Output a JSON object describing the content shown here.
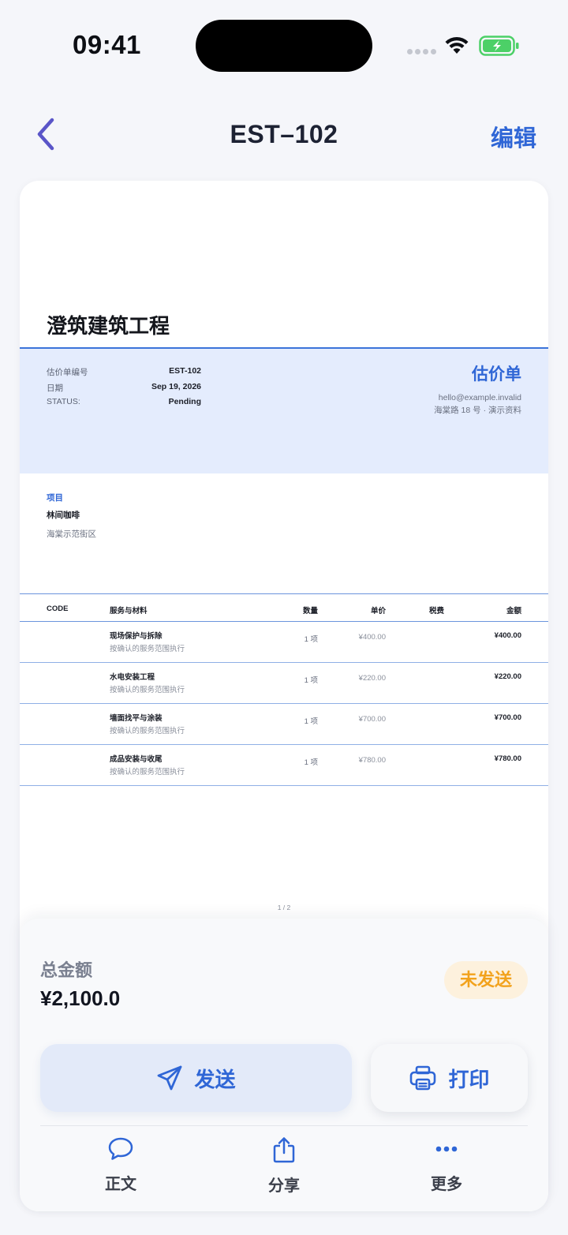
{
  "status_bar": {
    "time": "09:41"
  },
  "nav": {
    "title": "EST–102",
    "edit_label": "编辑"
  },
  "document": {
    "company": "澄筑建筑工程",
    "meta": [
      {
        "label": "估价单编号",
        "value": "EST-102"
      },
      {
        "label": "日期",
        "value": "Sep 19, 2026"
      },
      {
        "label": "STATUS:",
        "value": "Pending"
      }
    ],
    "doc_type": "估价单",
    "contact_email": "hello@example.invalid",
    "contact_address": "海棠路 18 号 · 演示资料",
    "project": {
      "label": "项目",
      "name": "林间咖啡",
      "address": "海棠示范街区"
    },
    "table": {
      "headers": {
        "code": "CODE",
        "item": "服务与材料",
        "qty": "数量",
        "price": "单价",
        "tax": "税费",
        "amount": "金额"
      },
      "rows": [
        {
          "name": "现场保护与拆除",
          "desc": "按确认的服务范围执行",
          "qty": "1 项",
          "price": "¥400.00",
          "amount": "¥400.00"
        },
        {
          "name": "水电安装工程",
          "desc": "按确认的服务范围执行",
          "qty": "1 项",
          "price": "¥220.00",
          "amount": "¥220.00"
        },
        {
          "name": "墙面找平与涂装",
          "desc": "按确认的服务范围执行",
          "qty": "1 项",
          "price": "¥700.00",
          "amount": "¥700.00"
        },
        {
          "name": "成品安装与收尾",
          "desc": "按确认的服务范围执行",
          "qty": "1 项",
          "price": "¥780.00",
          "amount": "¥780.00"
        }
      ]
    },
    "page_number": "1 / 2"
  },
  "panel": {
    "total_label": "总金额",
    "total_value": "¥2,100.0",
    "status_badge": "未发送",
    "send_label": "发送",
    "print_label": "打印",
    "tabs": [
      {
        "label": "正文",
        "icon": "chat-bubble-icon"
      },
      {
        "label": "分享",
        "icon": "share-icon"
      },
      {
        "label": "更多",
        "icon": "more-icon"
      }
    ]
  },
  "colors": {
    "accent": "#2f66d6",
    "band": "#e4ecfd",
    "badge_text": "#f2a21c",
    "badge_bg": "#fdf1dd",
    "back_chevron": "#5a55c8"
  }
}
